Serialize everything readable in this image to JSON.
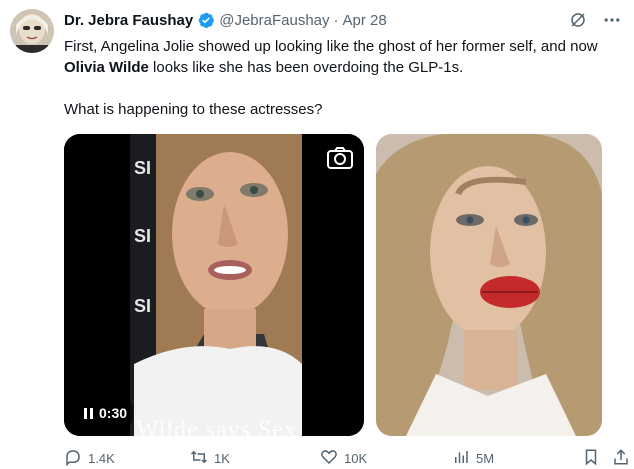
{
  "tweet": {
    "author_name": "Dr. Jebra Faushay",
    "handle": "@JebraFaushay",
    "separator": "·",
    "date": "Apr 28",
    "text_line1_pre": "First, Angelina Jolie showed up looking like the ghost of her former self, and now ",
    "text_bold": "Olivia Wilde",
    "text_line1_post": " looks like she has been overdoing the GLP-1s.",
    "text_line2": "What is happening to these actresses?"
  },
  "video": {
    "time": "0:30",
    "caption": "Wilde says Sex"
  },
  "actions": {
    "replies": "1.4K",
    "reposts": "1K",
    "likes": "10K",
    "views": "5M"
  },
  "colors": {
    "verified": "#1d9bf0",
    "secondary_text": "#536471",
    "primary_text": "#0f1419"
  },
  "icons": [
    "verified-badge-icon",
    "grok-icon",
    "more-icon",
    "camera-icon",
    "pause-icon",
    "reply-icon",
    "repost-icon",
    "like-icon",
    "views-icon",
    "bookmark-icon",
    "share-icon"
  ]
}
